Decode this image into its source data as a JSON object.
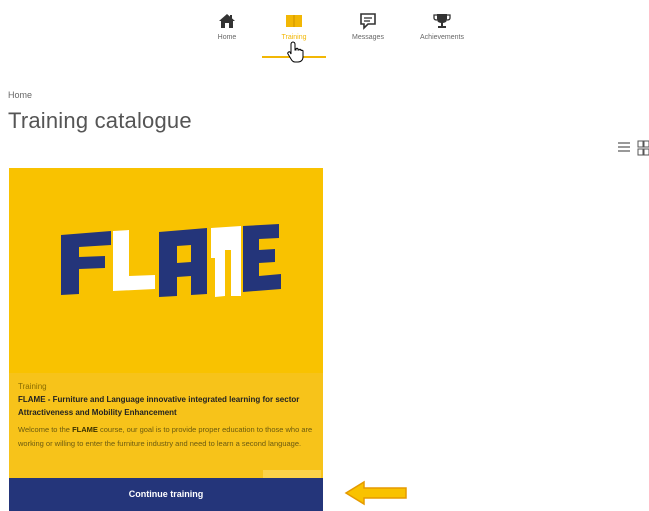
{
  "nav": {
    "items": [
      {
        "label": "Home",
        "icon": "home-icon"
      },
      {
        "label": "Training",
        "icon": "book-icon",
        "active": true
      },
      {
        "label": "Messages",
        "icon": "message-icon"
      },
      {
        "label": "Achievements",
        "icon": "trophy-icon"
      }
    ]
  },
  "breadcrumb": {
    "home": "Home"
  },
  "page": {
    "title": "Training catalogue"
  },
  "card": {
    "logo_text": "FLAME",
    "category": "Training",
    "title": "FLAME - Furniture and Language innovative integrated learning for sector Attractiveness and Mobility Enhancement",
    "desc_prefix": "Welcome to the ",
    "desc_bold": "FLAME",
    "desc_suffix": " course, our goal is to provide proper education to those who are working or willing to enter the furniture industry and need to learn a second language.",
    "cta": "Continue training"
  },
  "colors": {
    "accent": "#f2b705",
    "card_bg": "#f9c200",
    "cta_bg": "#24357a",
    "logo_blue": "#24357a"
  }
}
